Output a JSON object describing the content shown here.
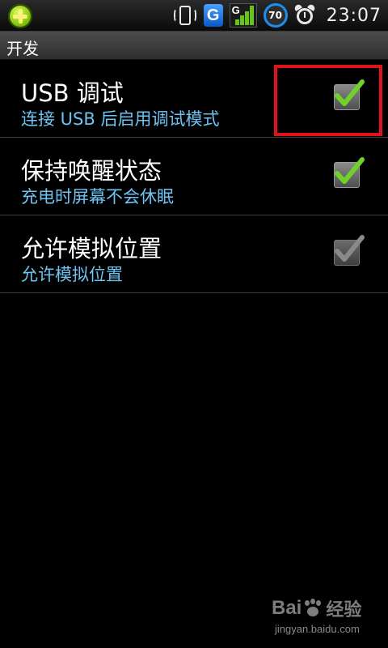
{
  "status_bar": {
    "icons": [
      "app-plus-icon",
      "phone-vibrate-icon",
      "g-app-icon",
      "signal-icon",
      "battery-icon",
      "alarm-icon"
    ],
    "battery_level": "70",
    "network_label": "G",
    "app_letter": "G",
    "time": "23:07"
  },
  "title_bar": {
    "title": "开发"
  },
  "settings": [
    {
      "title": "USB 调试",
      "summary": "连接 USB 后启用调试模式",
      "checked": true,
      "enabled": true
    },
    {
      "title": "保持唤醒状态",
      "summary": "充电时屏幕不会休眠",
      "checked": true,
      "enabled": true
    },
    {
      "title": "允许模拟位置",
      "summary": "允许模拟位置",
      "checked": true,
      "enabled": false
    }
  ],
  "annotation": {
    "highlight_color": "#e0121c"
  },
  "watermark": {
    "brand_left": "Bai",
    "brand_right": "经验",
    "url": "jingyan.baidu.com"
  },
  "colors": {
    "check_enabled": "#6fd12a",
    "check_disabled": "#8a8a8a",
    "summary_text": "#6ec3f3"
  }
}
